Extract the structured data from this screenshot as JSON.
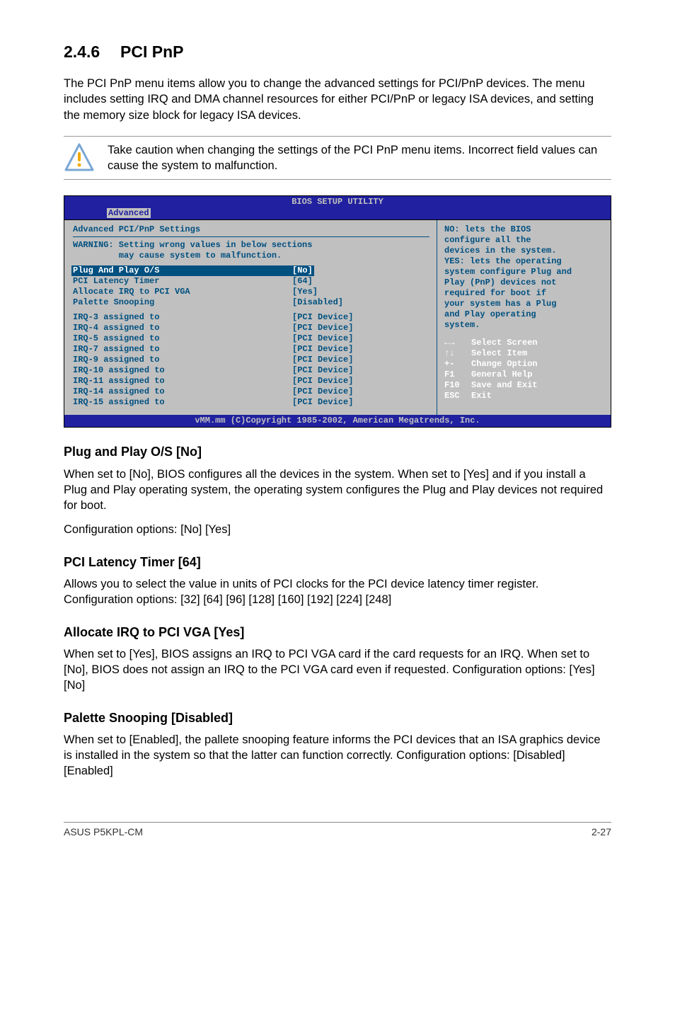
{
  "section": {
    "number": "2.4.6",
    "title": "PCI PnP"
  },
  "intro": "The PCI PnP menu items allow you to change the advanced settings for PCI/PnP devices. The menu includes setting IRQ and DMA channel resources for either PCI/PnP or legacy ISA devices, and setting the memory size block for legacy ISA devices.",
  "caution": "Take caution when changing the settings of the PCI PnP menu items. Incorrect field values can cause the system to malfunction.",
  "bios": {
    "title": "BIOS SETUP UTILITY",
    "tab": "Advanced",
    "panel_title": "Advanced PCI/PnP Settings",
    "warning_l1": "WARNING: Setting wrong values in below sections",
    "warning_l2": "         may cause system to malfunction.",
    "rows": [
      {
        "label": "Plug And Play O/S",
        "value": "[No]",
        "hilite": true
      },
      {
        "label": "PCI Latency Timer",
        "value": "[64]"
      },
      {
        "label": "Allocate IRQ to PCI VGA",
        "value": "[Yes]"
      },
      {
        "label": "Palette Snooping",
        "value": "[Disabled]"
      }
    ],
    "irq_rows": [
      {
        "label": "IRQ-3 assigned to",
        "value": "[PCI Device]"
      },
      {
        "label": "IRQ-4 assigned to",
        "value": "[PCI Device]"
      },
      {
        "label": "IRQ-5 assigned to",
        "value": "[PCI Device]"
      },
      {
        "label": "IRQ-7 assigned to",
        "value": "[PCI Device]"
      },
      {
        "label": "IRQ-9 assigned to",
        "value": "[PCI Device]"
      },
      {
        "label": "IRQ-10 assigned to",
        "value": "[PCI Device]"
      },
      {
        "label": "IRQ-11 assigned to",
        "value": "[PCI Device]"
      },
      {
        "label": "IRQ-14 assigned to",
        "value": "[PCI Device]"
      },
      {
        "label": "IRQ-15 assigned to",
        "value": "[PCI Device]"
      }
    ],
    "help": [
      "NO: lets the BIOS",
      "configure  all the",
      "devices in the system.",
      "YES: lets the operating",
      "system configure Plug and",
      "Play (PnP) devices not",
      "required for boot if",
      "your system has a Plug",
      "and Play operating",
      "system."
    ],
    "keys": [
      {
        "k": "←→",
        "d": "Select Screen"
      },
      {
        "k": "↑↓",
        "d": "Select Item"
      },
      {
        "k": "+-",
        "d": "Change Option"
      },
      {
        "k": "F1",
        "d": "General Help"
      },
      {
        "k": "F10",
        "d": "Save and Exit"
      },
      {
        "k": "ESC",
        "d": "Exit"
      }
    ],
    "footer": "vMM.mm (C)Copyright 1985-2002, American Megatrends, Inc."
  },
  "subs": {
    "s1": {
      "h": "Plug and Play O/S [No]",
      "p1": "When set to [No], BIOS configures all the devices in the system. When set to [Yes] and if you install a Plug and Play operating system, the operating system configures the Plug and Play devices not required for boot.",
      "p2": "Configuration options: [No] [Yes]"
    },
    "s2": {
      "h": "PCI Latency Timer [64]",
      "p": "Allows you to select the value in units of PCI clocks for the PCI device latency timer register. Configuration options: [32] [64] [96] [128] [160] [192] [224] [248]"
    },
    "s3": {
      "h": "Allocate IRQ to PCI VGA [Yes]",
      "p": "When set to [Yes], BIOS assigns an IRQ to PCI VGA card if the card requests for an IRQ. When set to [No], BIOS does not assign an IRQ to the PCI VGA card even if requested. Configuration options: [Yes] [No]"
    },
    "s4": {
      "h": "Palette Snooping [Disabled]",
      "p": "When set to [Enabled], the pallete snooping feature informs the PCI devices that an ISA graphics device is installed in the system so that the latter can function correctly. Configuration options: [Disabled] [Enabled]"
    }
  },
  "footer": {
    "left": "ASUS P5KPL-CM",
    "right": "2-27"
  }
}
